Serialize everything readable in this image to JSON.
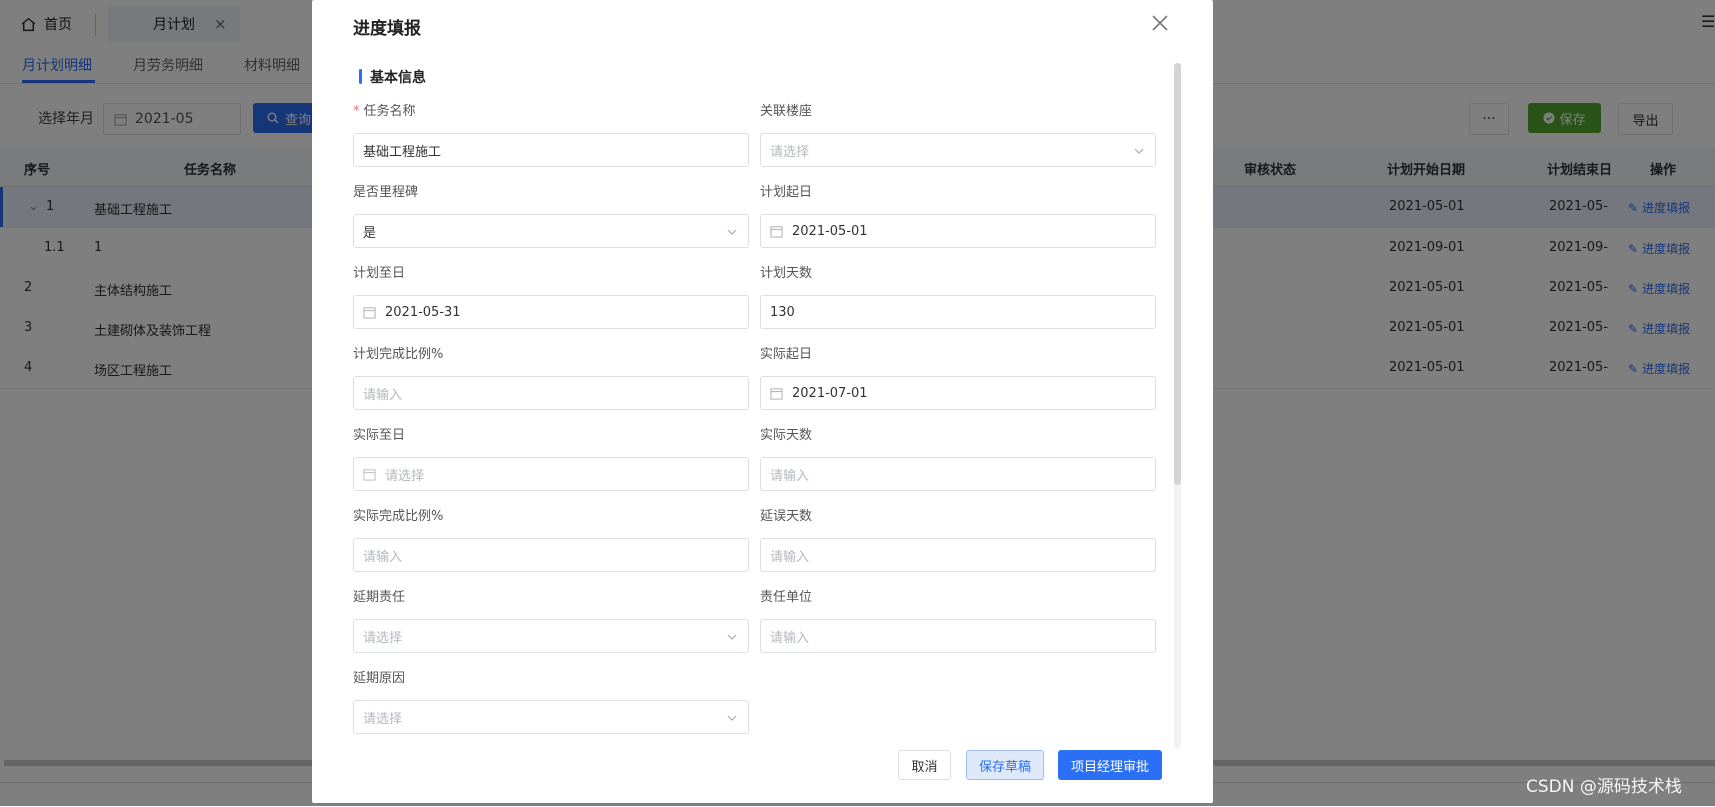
{
  "tabs": {
    "home_label": "首页",
    "page_label": "月计划",
    "close_glyph": "×"
  },
  "subtabs": [
    "月计划明细",
    "月劳务明细",
    "材料明细"
  ],
  "filter": {
    "label": "选择年月",
    "month_value": "2021-05",
    "query_label": "查询",
    "more_label": "···",
    "save_label": "保存",
    "export_label": "导出"
  },
  "table": {
    "headers": {
      "index": "序号",
      "task": "任务名称",
      "audit": "审核状态",
      "plan_start": "计划开始日期",
      "plan_end": "计划结束日",
      "action": "操作"
    },
    "rows": [
      {
        "index": "1",
        "task": "基础工程施工",
        "start": "2021-05-01",
        "end": "2021-05-",
        "action": "进度填报"
      },
      {
        "index": "1.1",
        "task": "1",
        "start": "2021-09-01",
        "end": "2021-09-",
        "action": "进度填报"
      },
      {
        "index": "2",
        "task": "主体结构施工",
        "start": "2021-05-01",
        "end": "2021-05-",
        "action": "进度填报"
      },
      {
        "index": "3",
        "task": "土建砌体及装饰工程",
        "start": "2021-05-01",
        "end": "2021-05-",
        "action": "进度填报"
      },
      {
        "index": "4",
        "task": "场区工程施工",
        "start": "2021-05-01",
        "end": "2021-05-",
        "action": "进度填报"
      }
    ]
  },
  "dialog": {
    "title": "进度填报",
    "section_title": "基本信息",
    "fields": {
      "task_name": {
        "label": "任务名称",
        "value": "基础工程施工"
      },
      "building": {
        "label": "关联楼座",
        "placeholder": "请选择"
      },
      "milestone": {
        "label": "是否里程碑",
        "value": "是"
      },
      "plan_start": {
        "label": "计划起日",
        "value": "2021-05-01"
      },
      "plan_end": {
        "label": "计划至日",
        "value": "2021-05-31"
      },
      "plan_days": {
        "label": "计划天数",
        "value": "130"
      },
      "plan_ratio": {
        "label": "计划完成比例%",
        "placeholder": "请输入"
      },
      "actual_start": {
        "label": "实际起日",
        "value": "2021-07-01"
      },
      "actual_end": {
        "label": "实际至日",
        "placeholder": "请选择"
      },
      "actual_days": {
        "label": "实际天数",
        "placeholder": "请输入"
      },
      "actual_ratio": {
        "label": "实际完成比例%",
        "placeholder": "请输入"
      },
      "delay_days": {
        "label": "延误天数",
        "placeholder": "请输入"
      },
      "delay_resp": {
        "label": "延期责任",
        "placeholder": "请选择"
      },
      "resp_unit": {
        "label": "责任单位",
        "placeholder": "请输入"
      },
      "delay_reason": {
        "label": "延期原因",
        "placeholder": "请选择"
      }
    },
    "buttons": {
      "cancel": "取消",
      "draft": "保存草稿",
      "approve": "项目经理审批"
    }
  },
  "watermark": "CSDN @源码技术栈",
  "colors": {
    "primary": "#2b6ff5",
    "success": "#52a72e",
    "required": "#f56c6c"
  }
}
